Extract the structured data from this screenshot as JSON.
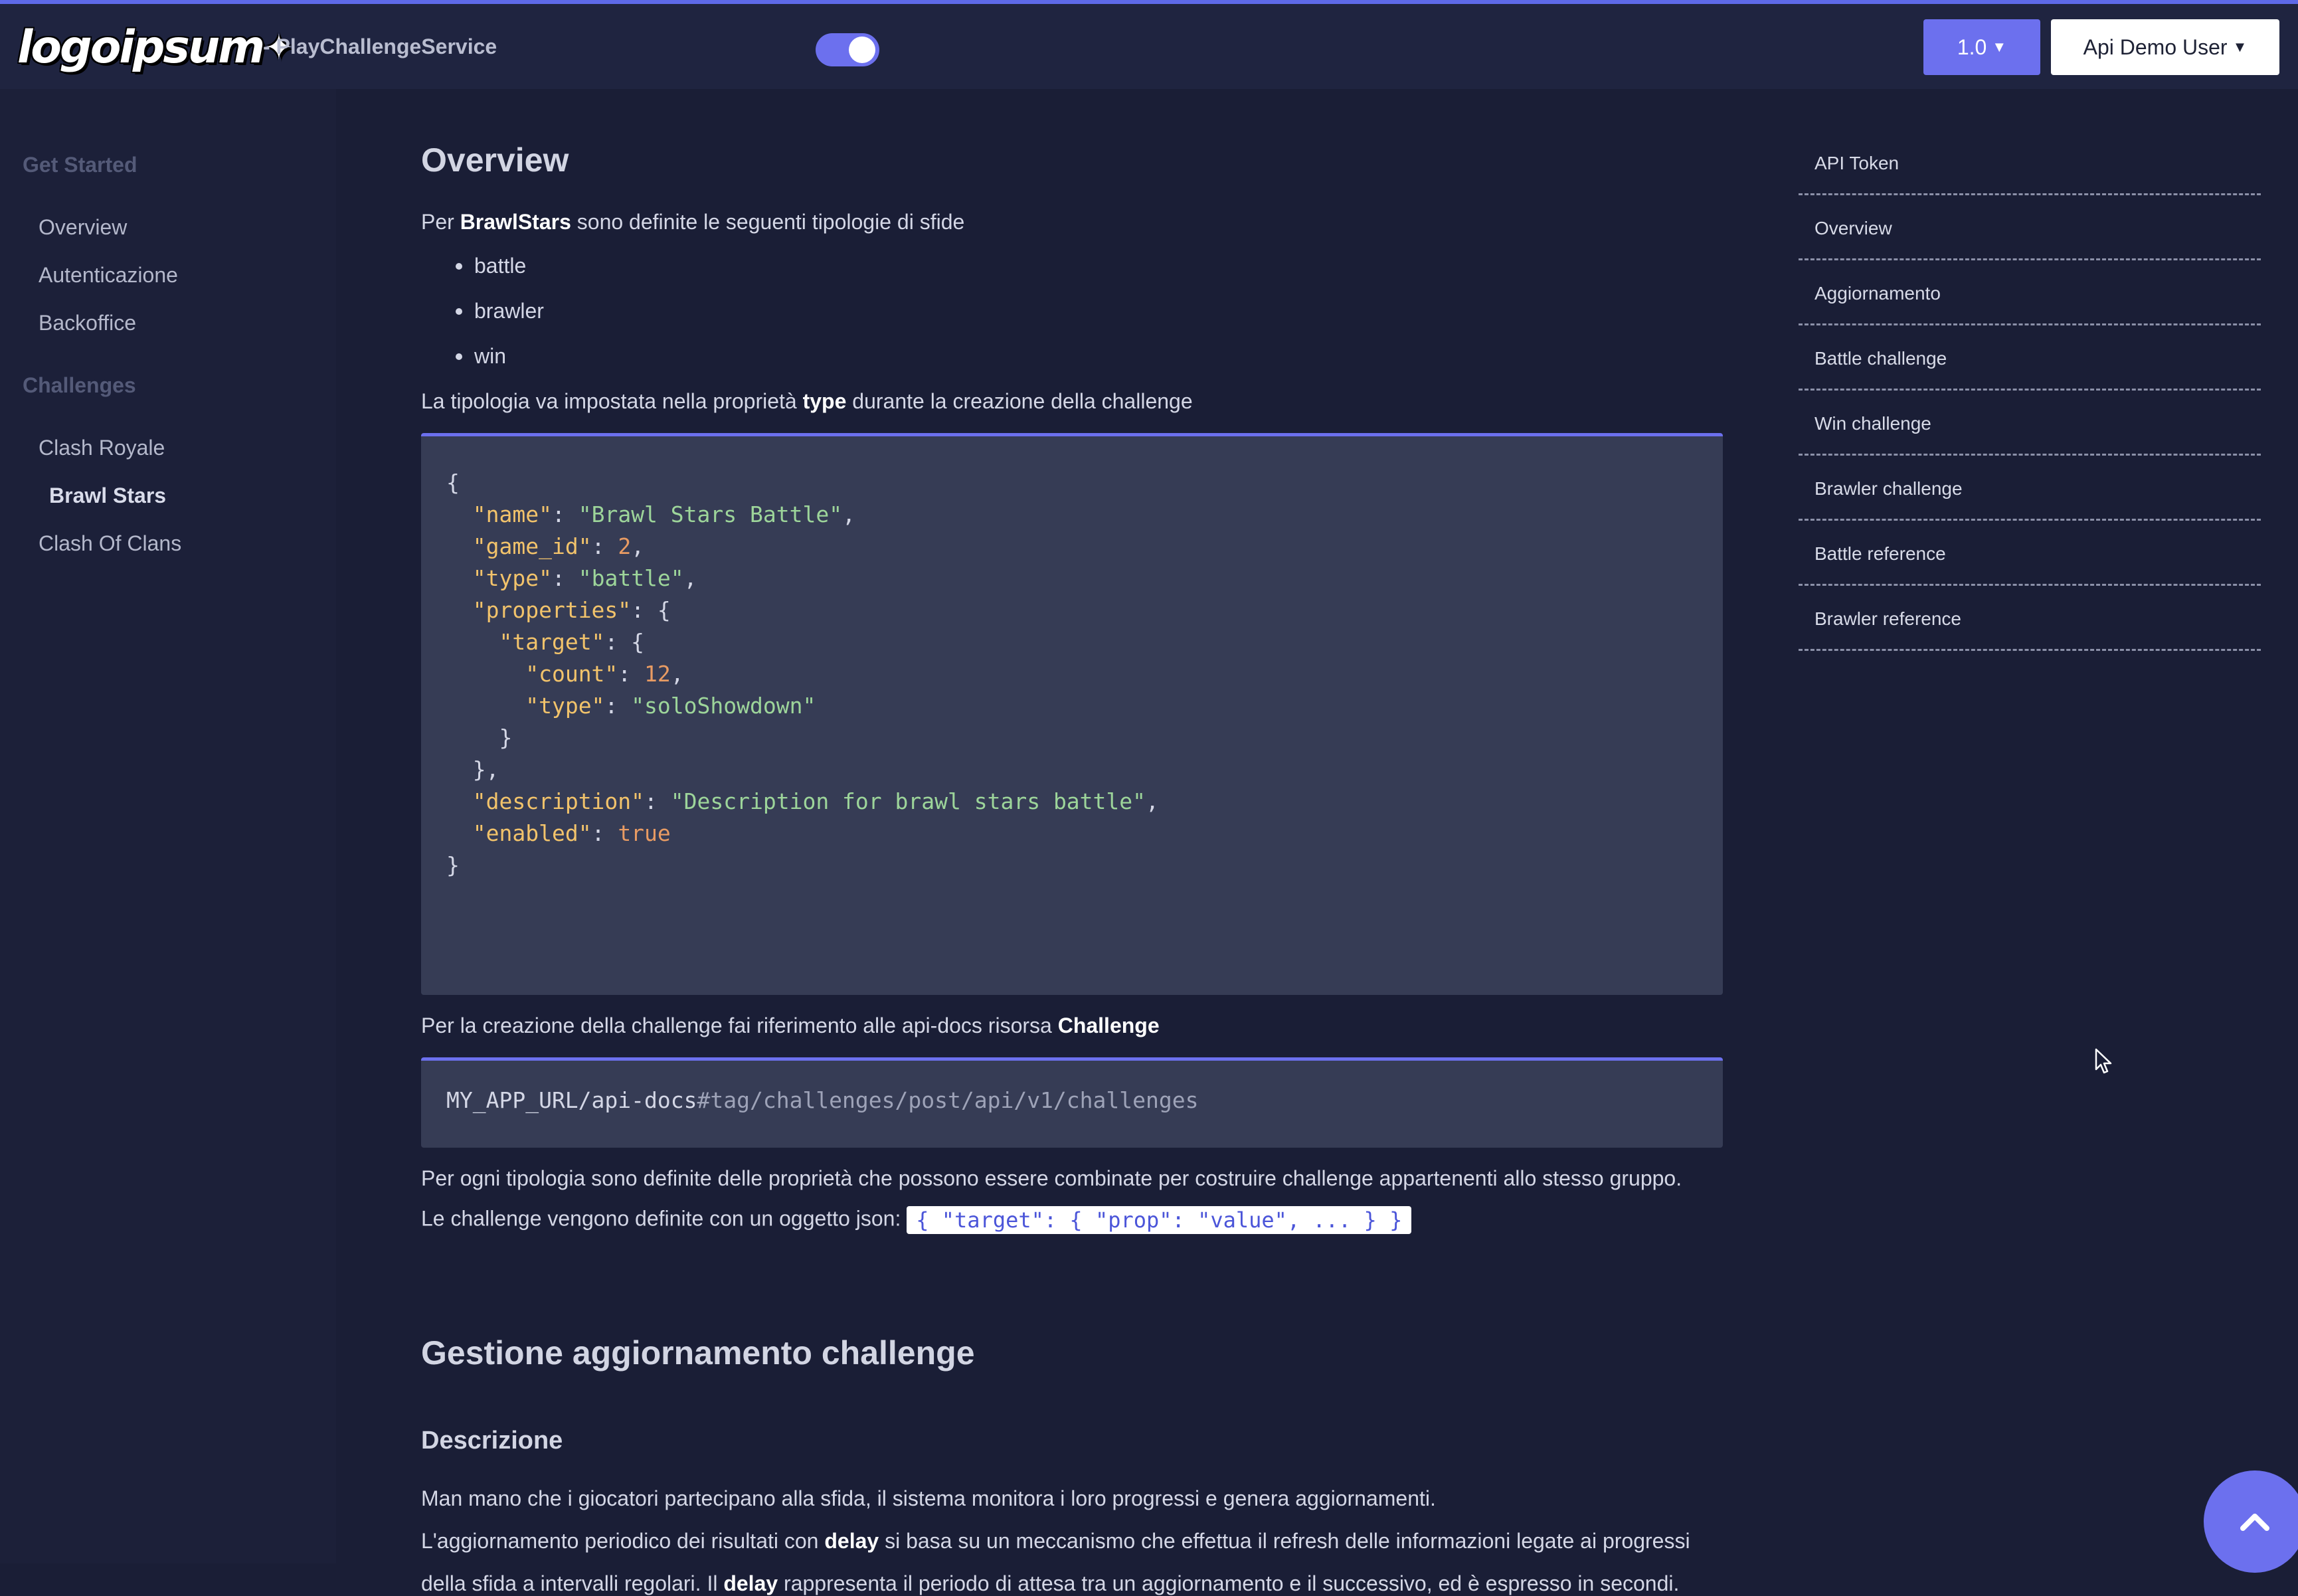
{
  "header": {
    "app_name": "- PlayChallengeService",
    "version": "1.0",
    "user": "Api Demo User"
  },
  "logo": {
    "text": "logoipsum"
  },
  "sidebar": {
    "groups": [
      {
        "label": "Get Started",
        "items": [
          "Overview",
          "Autenticazione",
          "Backoffice"
        ]
      },
      {
        "label": "Challenges",
        "items": [
          "Clash Royale",
          "Brawl Stars",
          "Clash Of Clans"
        ]
      }
    ],
    "active": "Brawl Stars"
  },
  "content": {
    "title": "Overview",
    "intro_prefix": "Per ",
    "intro_bold": "BrawlStars",
    "intro_suffix": " sono definite le seguenti tipologie di sfide",
    "types": [
      "battle",
      "brawler",
      "win"
    ],
    "type_prefix": "La tipologia va impostata nella proprietà ",
    "type_bold": "type",
    "type_suffix": " durante la creazione della challenge",
    "ref_prefix": "Per la creazione della challenge fai riferimento alle api-docs risorsa ",
    "ref_bold": "Challenge",
    "url_path": "MY_APP_URL/api-docs",
    "url_hash": "#tag/challenges/post/api/v1/challenges",
    "props_line": "Per ogni tipologia sono definite delle proprietà che possono essere combinate per costruire challenge appartenenti allo stesso gruppo.",
    "json_prefix": "Le challenge vengono definite con un oggetto json: ",
    "json_inline": "{ \"target\": { \"prop\": \"value\", ... } }",
    "section_title": "Gestione aggiornamento challenge",
    "sub_title": "Descrizione",
    "desc_line1": "Man mano che i giocatori partecipano alla sfida, il sistema monitora i loro progressi e genera aggiornamenti.",
    "desc2_prefix": "L'aggiornamento periodico dei risultati con ",
    "desc2_bold": "delay",
    "desc2_suffix": " si basa su un meccanismo che effettua il refresh delle informazioni legate ai progressi",
    "desc3_prefix": "della sfida a intervalli regolari. Il ",
    "desc3_bold": "delay",
    "desc3_suffix": " rappresenta il periodo di attesa tra un aggiornamento e il successivo, ed è espresso in secondi."
  },
  "code": {
    "name_key": "\"name\"",
    "name_val": "\"Brawl Stars Battle\"",
    "game_key": "\"game_id\"",
    "game_val": "2",
    "type_key": "\"type\"",
    "type_val": "\"battle\"",
    "props_key": "\"properties\"",
    "target_key": "\"target\"",
    "count_key": "\"count\"",
    "count_val": "12",
    "ttype_key": "\"type\"",
    "ttype_val": "\"soloShowdown\"",
    "desc_key": "\"description\"",
    "desc_val": "\"Description for brawl stars battle\"",
    "enabled_key": "\"enabled\"",
    "enabled_val": "true"
  },
  "toc": [
    "API Token",
    "Overview",
    "Aggiornamento",
    "Battle challenge",
    "Win challenge",
    "Brawler challenge",
    "Battle reference",
    "Brawler reference"
  ],
  "icons": {
    "toggle": "toggle-icon",
    "scroll_top": "arrow-up-icon",
    "cursor": "mouse-cursor-icon"
  },
  "colors": {
    "accent": "#6c70ee",
    "background": "#1a1e36",
    "code_bg": "#363c55"
  }
}
